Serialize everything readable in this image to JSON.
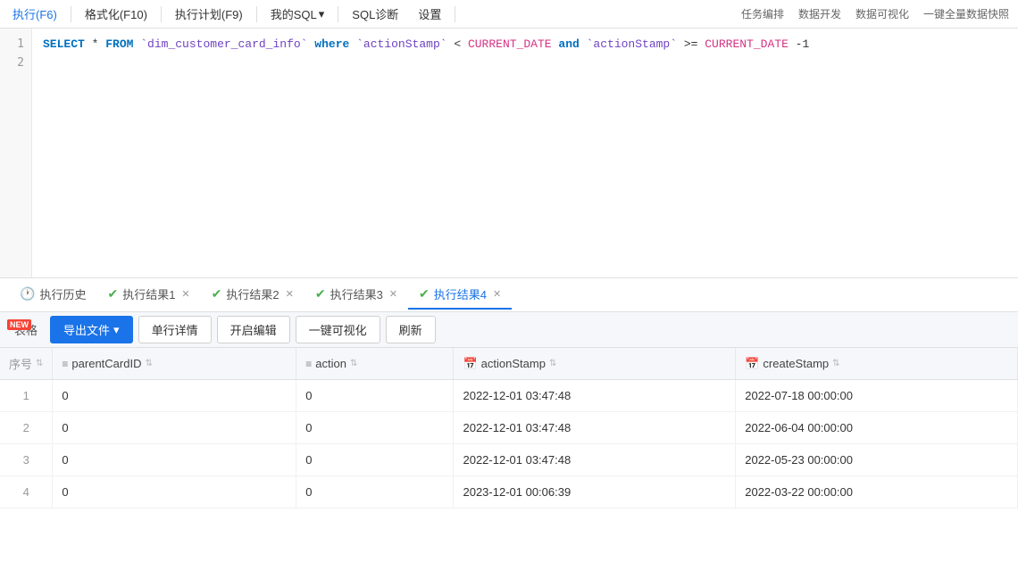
{
  "toolbar": {
    "buttons": [
      {
        "label": "执行(F6)",
        "id": "execute"
      },
      {
        "label": "格式化(F10)",
        "id": "format"
      },
      {
        "label": "执行计划(F9)",
        "id": "plan"
      },
      {
        "label": "我的SQL",
        "id": "my-sql",
        "hasArrow": true
      },
      {
        "label": "SQL诊断",
        "id": "diagnose"
      },
      {
        "label": "设置",
        "id": "settings"
      }
    ],
    "right_items": [
      "任务编排",
      "数据开发",
      "数据可视化",
      "一键全量数据快照"
    ]
  },
  "sql": {
    "line1": "SELECT * FROM `dim_customer_card_info` where `actionStamp` < CURRENT_DATE and `actionStamp` >= CURRENT_DATE -1",
    "line2": ""
  },
  "result_tabs": [
    {
      "label": "执行历史",
      "id": "history",
      "closable": false,
      "active": false
    },
    {
      "label": "执行结果1",
      "id": "result1",
      "closable": true,
      "active": false
    },
    {
      "label": "执行结果2",
      "id": "result2",
      "closable": true,
      "active": false
    },
    {
      "label": "执行结果3",
      "id": "result3",
      "closable": true,
      "active": false
    },
    {
      "label": "执行结果4",
      "id": "result4",
      "closable": true,
      "active": true
    }
  ],
  "action_buttons": [
    {
      "label": "表格",
      "id": "table-view",
      "isNew": true
    },
    {
      "label": "导出文件",
      "id": "export",
      "hasArrow": true,
      "primary": true
    },
    {
      "label": "单行详情",
      "id": "row-detail"
    },
    {
      "label": "开启编辑",
      "id": "enable-edit"
    },
    {
      "label": "一键可视化",
      "id": "visualize"
    },
    {
      "label": "刷新",
      "id": "refresh"
    }
  ],
  "table": {
    "columns": [
      {
        "label": "序号",
        "id": "rownum",
        "type": "index"
      },
      {
        "label": "parentCardID",
        "id": "parentCardID",
        "type": "list"
      },
      {
        "label": "action",
        "id": "action",
        "type": "list"
      },
      {
        "label": "actionStamp",
        "id": "actionStamp",
        "type": "calendar"
      },
      {
        "label": "createStamp",
        "id": "createStamp",
        "type": "calendar"
      }
    ],
    "rows": [
      {
        "rownum": "1",
        "parentCardID": "0",
        "action": "0",
        "actionStamp": "2022-12-01 03:47:48",
        "createStamp": "2022-07-18 00:00:00"
      },
      {
        "rownum": "2",
        "parentCardID": "0",
        "action": "0",
        "actionStamp": "2022-12-01 03:47:48",
        "createStamp": "2022-06-04 00:00:00"
      },
      {
        "rownum": "3",
        "parentCardID": "0",
        "action": "0",
        "actionStamp": "2022-12-01 03:47:48",
        "createStamp": "2022-05-23 00:00:00"
      },
      {
        "rownum": "4",
        "parentCardID": "0",
        "action": "0",
        "actionStamp": "2023-12-01 00:06:39",
        "createStamp": "2022-03-22 00:00:00"
      }
    ]
  }
}
